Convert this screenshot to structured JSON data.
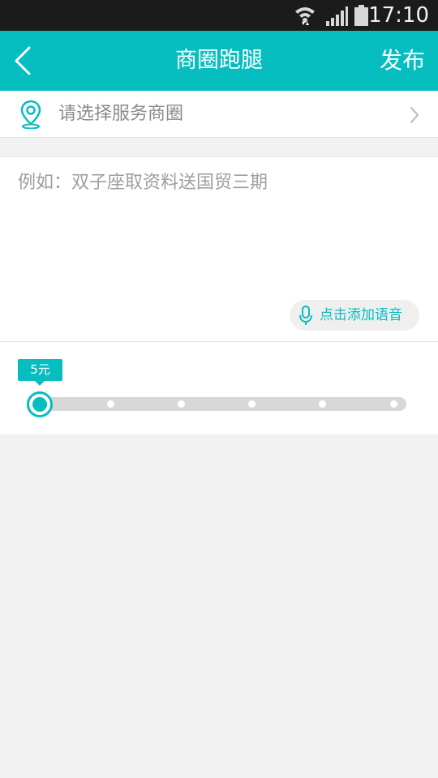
{
  "status_bar": {
    "time": "17:10",
    "icons": [
      "wifi-icon",
      "signal-icon",
      "battery-icon"
    ]
  },
  "header": {
    "title": "商圈跑腿",
    "publish_label": "发布",
    "back_icon": "chevron-left-icon"
  },
  "district": {
    "placeholder": "请选择服务商圈",
    "icon": "location-pin-icon",
    "chevron_icon": "chevron-right-icon"
  },
  "task": {
    "placeholder": "例如：双子座取资料送国贸三期",
    "value": "",
    "voice_label": "点击添加语音",
    "voice_icon": "microphone-icon"
  },
  "price": {
    "label": "5元",
    "steps": 6,
    "selected_index": 0
  },
  "colors": {
    "accent": "#06bdbf",
    "status_bar": "#1b1b1b",
    "background": "#f2f2f2"
  }
}
